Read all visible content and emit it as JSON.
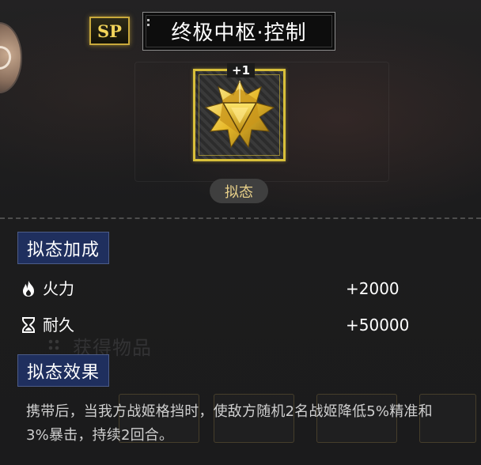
{
  "header": {
    "badge": "SP",
    "title": "终极中枢·控制"
  },
  "item": {
    "level_tag": "+1",
    "icon": "golden-star-crystal-icon",
    "tag": "拟态"
  },
  "bonus_section": {
    "title": "拟态加成",
    "stats": [
      {
        "icon": "flame-icon",
        "label": "火力",
        "value": "+2000"
      },
      {
        "icon": "hourglass-icon",
        "label": "耐久",
        "value": "+50000"
      }
    ]
  },
  "effect_section": {
    "title": "拟态效果",
    "description": "携带后，当我方战姬格挡时，使敌方随机2名战姬降低5%精准和3%暴击，持续2回合。"
  },
  "background": {
    "ghost_text": "获得物品"
  },
  "colors": {
    "gold": "#d8bf3a",
    "section_header_bg": "#1f2f5e",
    "panel_bg": "#1a1a1b"
  }
}
